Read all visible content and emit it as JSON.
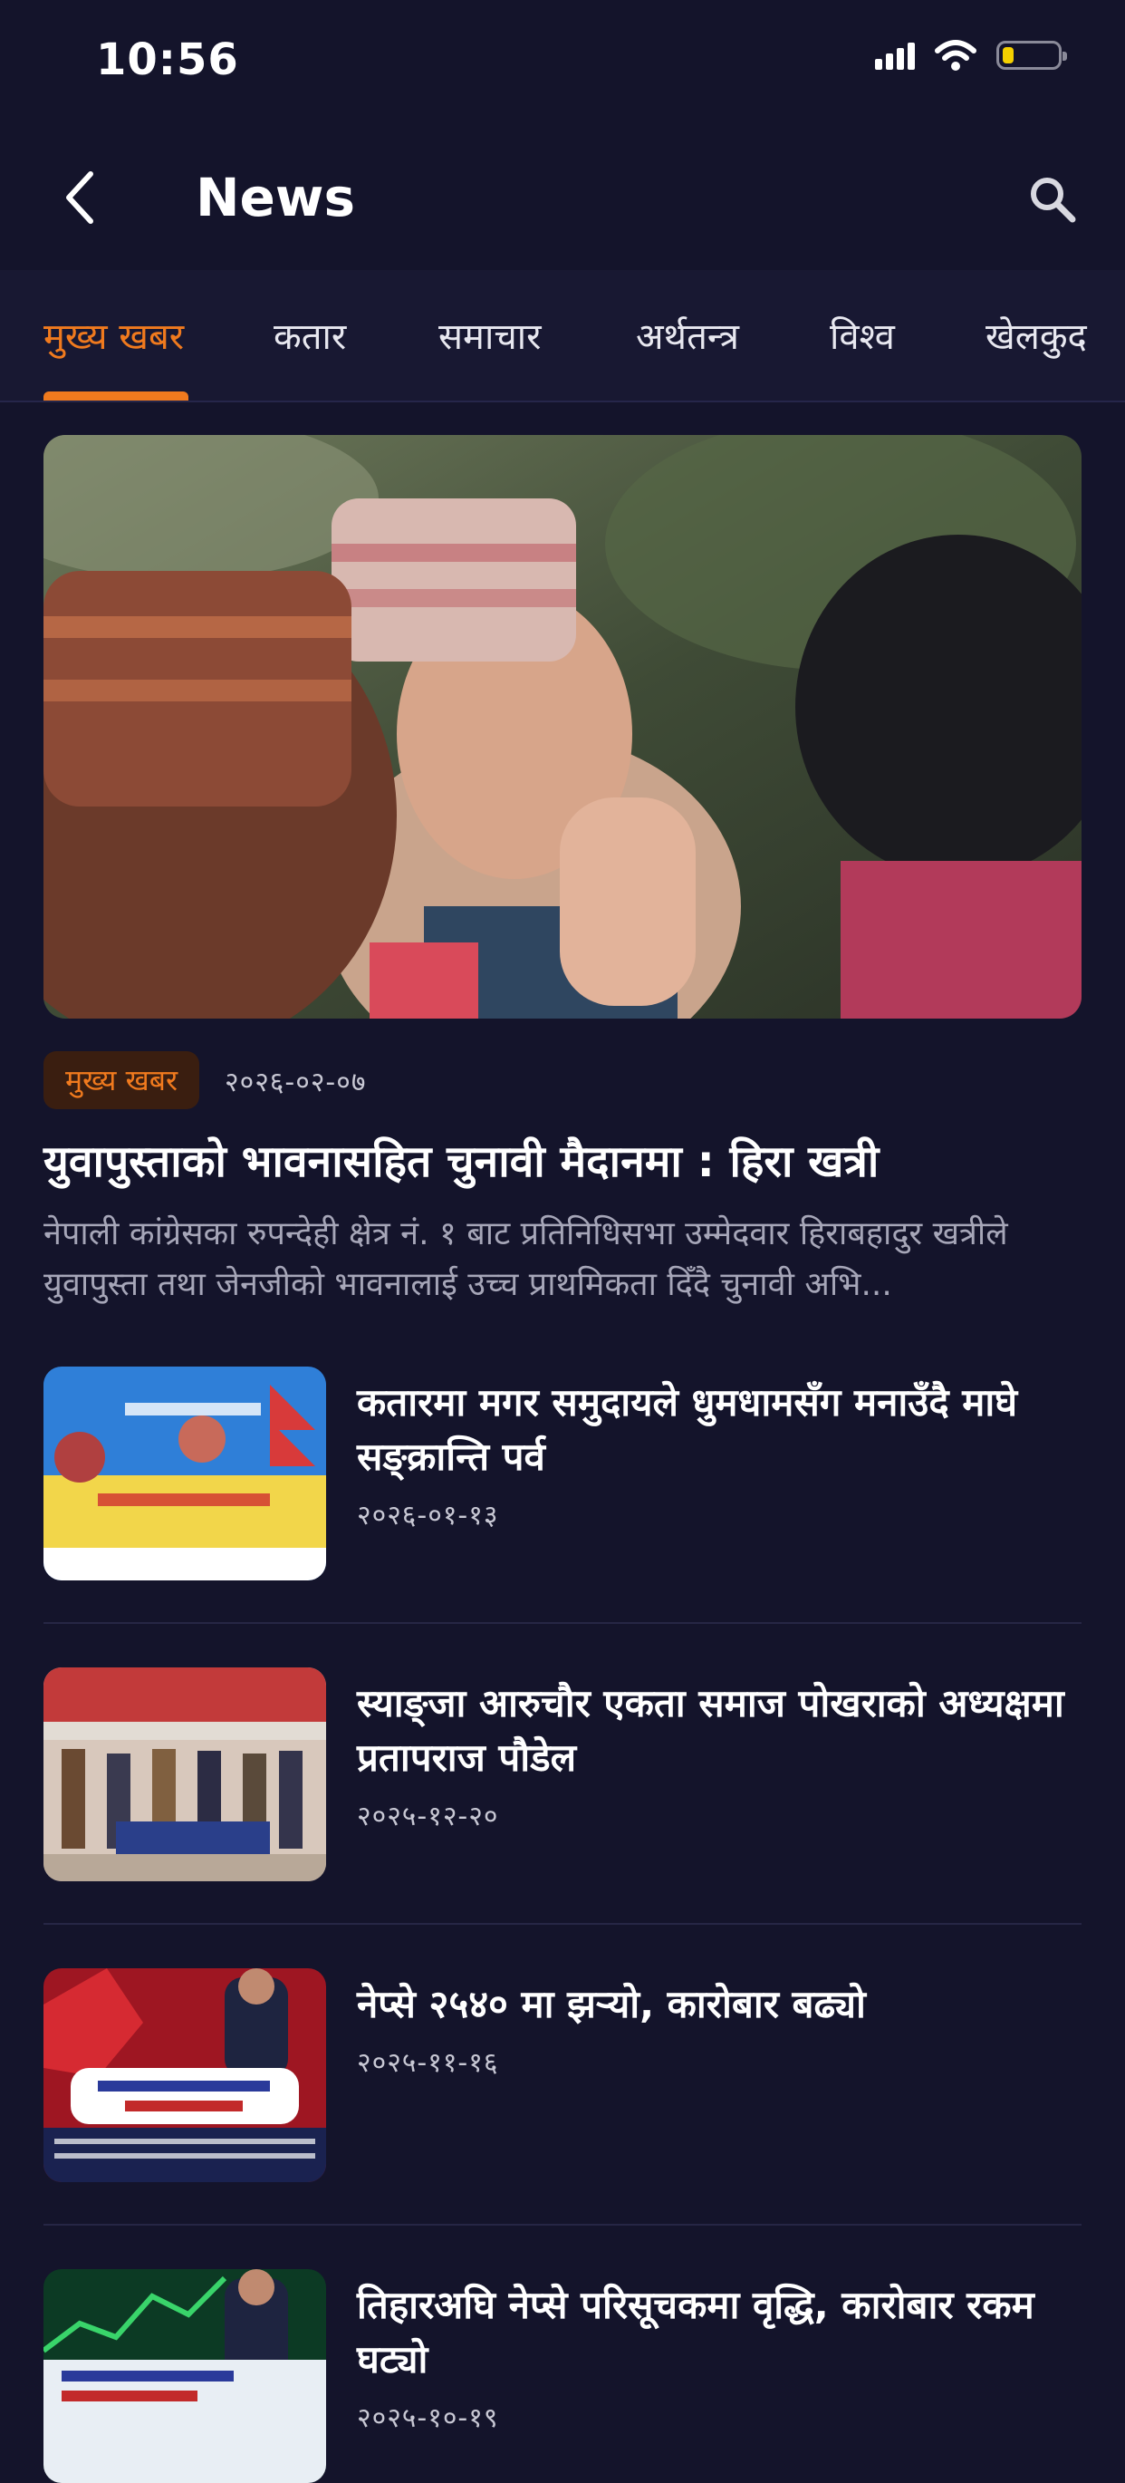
{
  "status_bar": {
    "time": "10:56",
    "battery_level": 0.2
  },
  "header": {
    "title": "News"
  },
  "tabs": [
    {
      "label": "मुख्य खबर",
      "active": true
    },
    {
      "label": "कतार",
      "active": false
    },
    {
      "label": "समाचार",
      "active": false
    },
    {
      "label": "अर्थतन्त्र",
      "active": false
    },
    {
      "label": "विश्व",
      "active": false
    },
    {
      "label": "खेलकुद",
      "active": false
    }
  ],
  "featured": {
    "tag": "मुख्य खबर",
    "date": "२०२६-०२-०७",
    "title": "युवापुस्ताको भावनासहित चुनावी मैदानमा : हिरा खत्री",
    "summary": "नेपाली कांग्रेसका रुपन्देही क्षेत्र नं. १ बाट प्रतिनिधिसभा उम्मेदवार हिराबहादुर खत्रीले युवापुस्ता तथा जेनजीको भावनालाई उच्च प्राथमिकता दिँदै चुनावी अभि..."
  },
  "news": [
    {
      "title": "कतारमा मगर समुदायले धुमधामसँग मनाउँदै माघे सङ्क्रान्ति पर्व",
      "date": "२०२६-०१-१३"
    },
    {
      "title": "स्याङ्जा आरुचौर एकता समाज पोखराको अध्यक्षमा प्रतापराज पौडेल",
      "date": "२०२५-१२-२०"
    },
    {
      "title": "नेप्से २५४० मा झर्‍यो, कारोबार बढ्यो",
      "date": "२०२५-११-१६"
    },
    {
      "title": "तिहारअघि नेप्से परिसूचकमा वृद्धि, कारोबार रकम घट्यो",
      "date": "२०२५-१०-१९"
    }
  ],
  "colors": {
    "accent": "#f07a1e",
    "background": "#14142b",
    "tab_bar": "#181832"
  }
}
